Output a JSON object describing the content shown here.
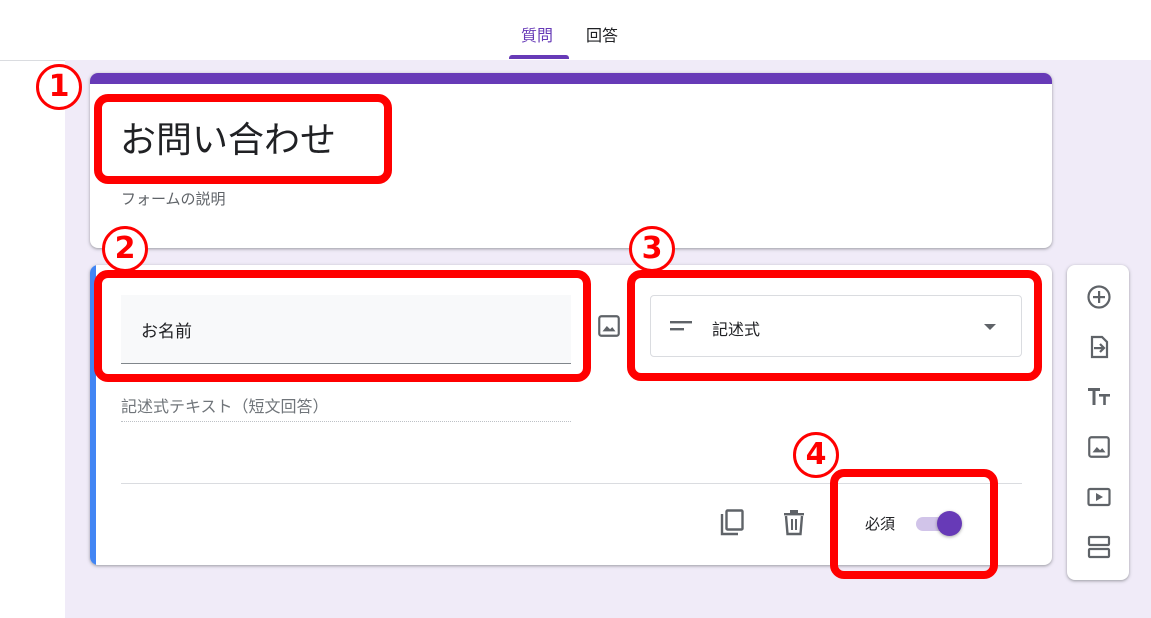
{
  "tabs": [
    {
      "label": "質問",
      "active": true
    },
    {
      "label": "回答",
      "active": false
    }
  ],
  "form": {
    "title": "お問い合わせ",
    "description": "フォームの説明"
  },
  "question": {
    "title": "お名前",
    "type_label": "記述式",
    "answer_hint": "記述式テキスト（短文回答）",
    "required_label": "必須",
    "required": true
  },
  "toolbar": {
    "items": [
      {
        "icon": "add-question-icon"
      },
      {
        "icon": "import-questions-icon"
      },
      {
        "icon": "add-title-icon"
      },
      {
        "icon": "add-image-icon"
      },
      {
        "icon": "add-video-icon"
      },
      {
        "icon": "add-section-icon"
      }
    ]
  },
  "annotations": [
    "1",
    "2",
    "3",
    "4"
  ],
  "colors": {
    "accent": "#673ab7",
    "canvas": "#f0ebf8",
    "active_question_bar": "#4285f4",
    "annotation": "#ff0000"
  }
}
